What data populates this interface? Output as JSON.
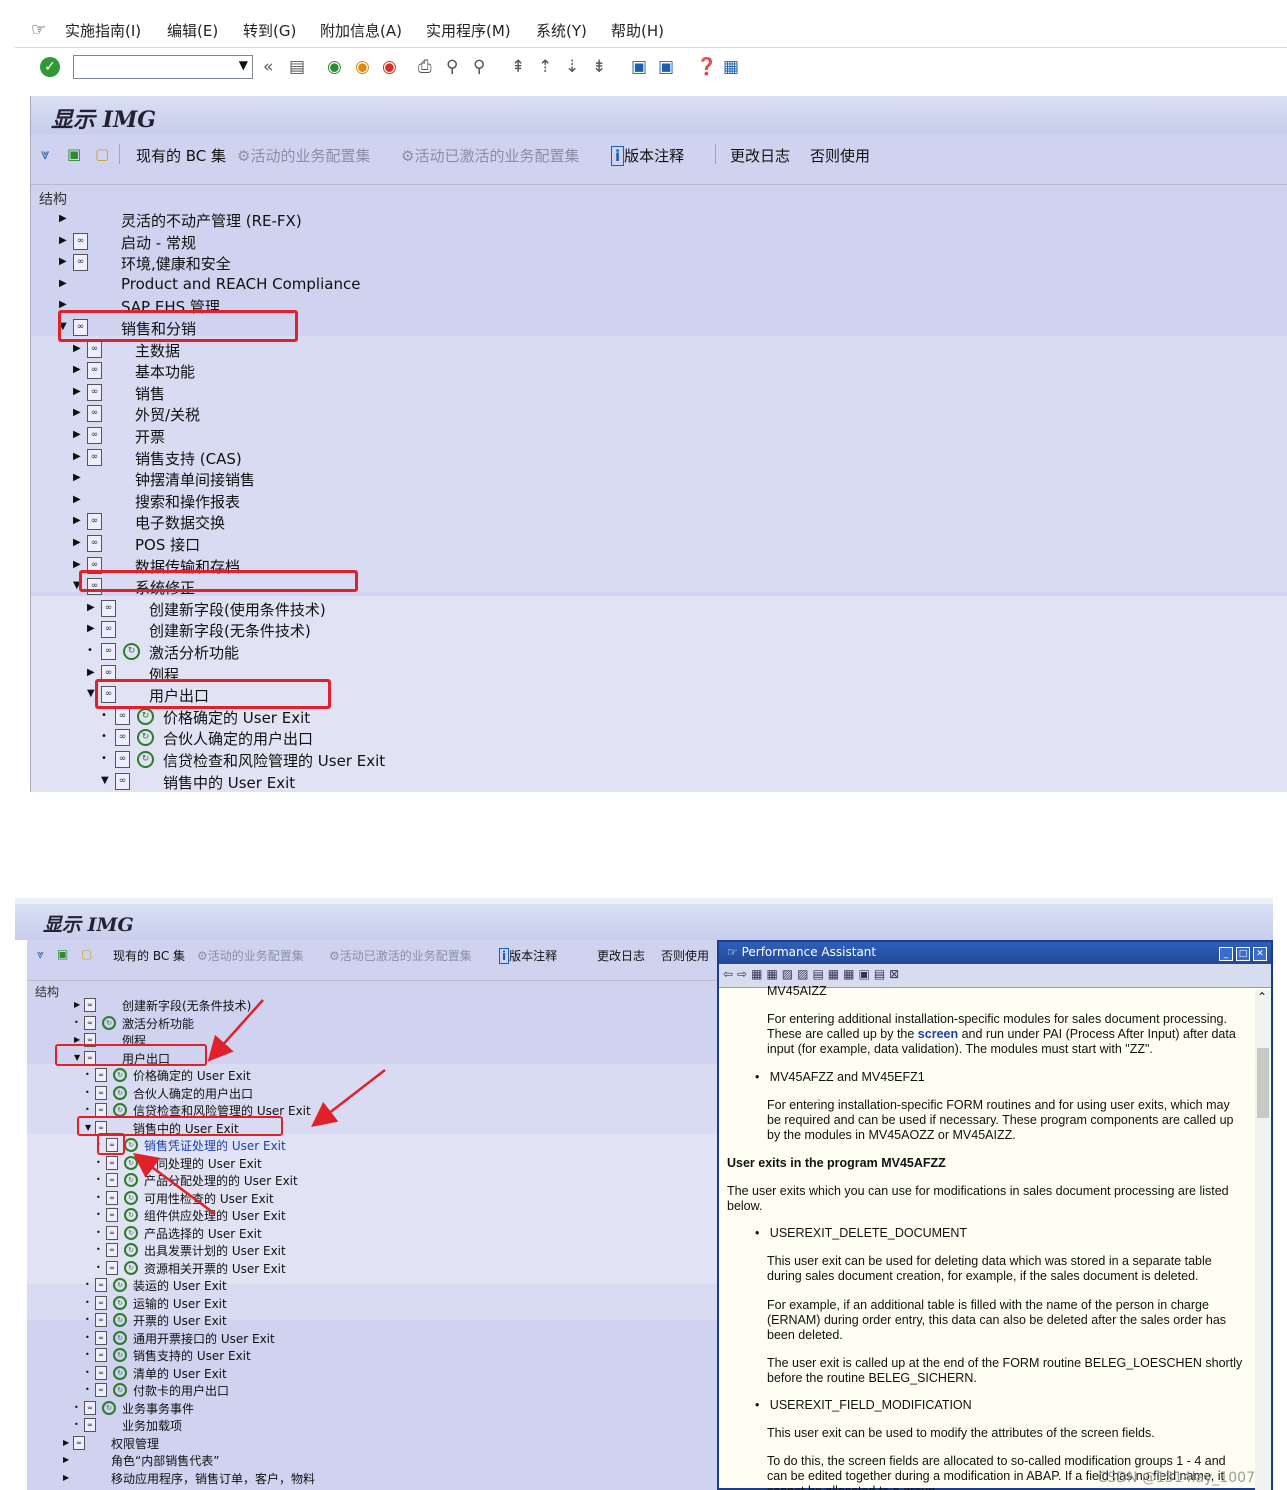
{
  "menu": [
    "实施指南(I)",
    "编辑(E)",
    "转到(G)",
    "附加信息(A)",
    "实用程序(M)",
    "系统(Y)",
    "帮助(H)"
  ],
  "title": "显示 IMG",
  "toolbar": {
    "bc_sets": "现有的 BC 集",
    "active_bc": "活动的业务配置集",
    "activated_bc": "活动已激活的业务配置集",
    "release_notes": "版本注释",
    "change_log": "更改日志",
    "deprecated": "否则使用"
  },
  "structure_label": "结构",
  "tree1": [
    "灵活的不动产管理 (RE-FX)",
    "启动 - 常规",
    "环境,健康和安全",
    "Product and REACH Compliance",
    "SAP EHS 管理",
    "销售和分销",
    "主数据",
    "基本功能",
    "销售",
    "外贸/关税",
    "开票",
    "销售支持 (CAS)",
    "钟摆清单间接销售",
    "搜索和操作报表",
    "电子数据交换",
    "POS 接口",
    "数据传输和存档",
    "系统修正",
    "创建新字段(使用条件技术)",
    "创建新字段(无条件技术)",
    "激活分析功能",
    "例程",
    "用户出口",
    "价格确定的 User Exit",
    "合伙人确定的用户出口",
    "信贷检查和风险管理的 User Exit",
    "销售中的 User Exit"
  ],
  "tree2": [
    "创建新字段(无条件技术)",
    "激活分析功能",
    "例程",
    "用户出口",
    "价格确定的 User Exit",
    "合伙人确定的用户出口",
    "信贷检查和风险管理的 User Exit",
    "销售中的 User Exit",
    "销售凭证处理的 User Exit",
    "合同处理的 User Exit",
    "产品分配处理的的 User Exit",
    "可用性检查的 User Exit",
    "组件供应处理的 User Exit",
    "产品选择的 User Exit",
    "出具发票计划的 User Exit",
    "资源相关开票的 User Exit",
    "装运的 User Exit",
    "运输的 User Exit",
    "开票的 User Exit",
    "通用开票接口的 User Exit",
    "销售支持的 User Exit",
    "清单的 User Exit",
    "付款卡的用户出口",
    "业务事务事件",
    "业务加载项",
    "权限管理",
    "角色“内部销售代表”",
    "移动应用程序，销售订单，客户，物料"
  ],
  "assistant": {
    "title": "Performance Assistant",
    "cut": "MV45AIZZ",
    "p1a": "For entering additional installation-specific modules for sales document processing. These are called up by the ",
    "p1k": "screen",
    "p1b": " and run under PAI (Process After Input) after data input (for example, data validation). The modules must start with \"ZZ\".",
    "b1": "MV45AFZZ and MV45EFZ1",
    "p2": "For entering installation-specific FORM routines and for using user exits, which may be required and can be used if necessary. These program components are called up by the modules in MV45AOZZ or MV45AIZZ.",
    "h1": "User exits in the program MV45AFZZ",
    "p3": "The user exits which you can use for modifications in sales document processing are listed below.",
    "b2": "USEREXIT_DELETE_DOCUMENT",
    "p4": "This user exit can be used for deleting data which was stored in a separate table during sales document creation, for example, if the sales document is deleted.",
    "p5": "For example, if an additional table is filled with the name of the person in charge (ERNAM) during order entry, this data can also be deleted after the sales order has been deleted.",
    "p6": "The user exit is called up at the end of the FORM routine BELEG_LOESCHEN shortly before the routine BELEG_SICHERN.",
    "b3": "USEREXIT_FIELD_MODIFICATION",
    "p7": "This user exit can be used to modify the attributes of the screen fields.",
    "p8": "To do this, the screen fields are allocated to so-called modification groups 1 - 4 and can be edited together during a modification in ABAP. If a field has no field name, it cannot be allocated to a group."
  },
  "watermark": "CSDN @1314lay_1007"
}
